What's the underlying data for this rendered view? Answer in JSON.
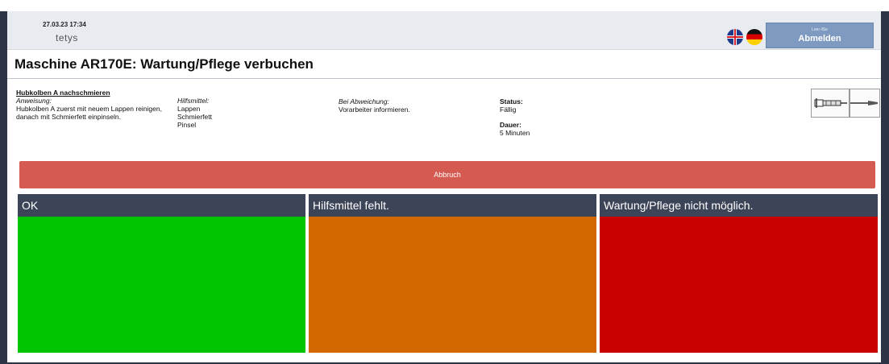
{
  "header": {
    "datetime": "27.03.23 17:34",
    "logo_text": "tetys",
    "languages": [
      {
        "name": "English",
        "icon": "uk-flag-icon"
      },
      {
        "name": "Deutsch",
        "icon": "german-flag-icon"
      }
    ],
    "logout": {
      "user": "Leer ilSe",
      "label": "Abmelden"
    }
  },
  "page": {
    "title": "Maschine AR170E: Wartung/Pflege verbuchen"
  },
  "task": {
    "title": "Hubkolben A nachschmieren",
    "instruction_label": "Anweisung:",
    "instruction_text": "Hubkolben A zuerst mit neuem Lappen reinigen, danach mit Schmierfett einpinseln.",
    "tools_label": "Hilfsmittel:",
    "tools": [
      "Lappen",
      "Schmierfett",
      "Pinsel"
    ],
    "deviation_label": "Bei Abweichung:",
    "deviation_text": "Vorarbeiter informieren.",
    "status_label": "Status:",
    "status_value": "Fällig",
    "duration_label": "Dauer:",
    "duration_value": "5 Minuten"
  },
  "actions": {
    "cancel_label": "Abbruch",
    "options": [
      {
        "label": "OK",
        "color": "#00c400"
      },
      {
        "label": "Hilfsmittel fehlt.",
        "color": "#d46800"
      },
      {
        "label": "Wartung/Pflege nicht möglich.",
        "color": "#c80000"
      }
    ]
  },
  "colors": {
    "header_bg": "#e8ebf0",
    "logout_bg": "#7e9ac0",
    "cancel_bg": "#d45a52",
    "option_header_bg": "#3c4458",
    "frame": "#2d3446"
  }
}
